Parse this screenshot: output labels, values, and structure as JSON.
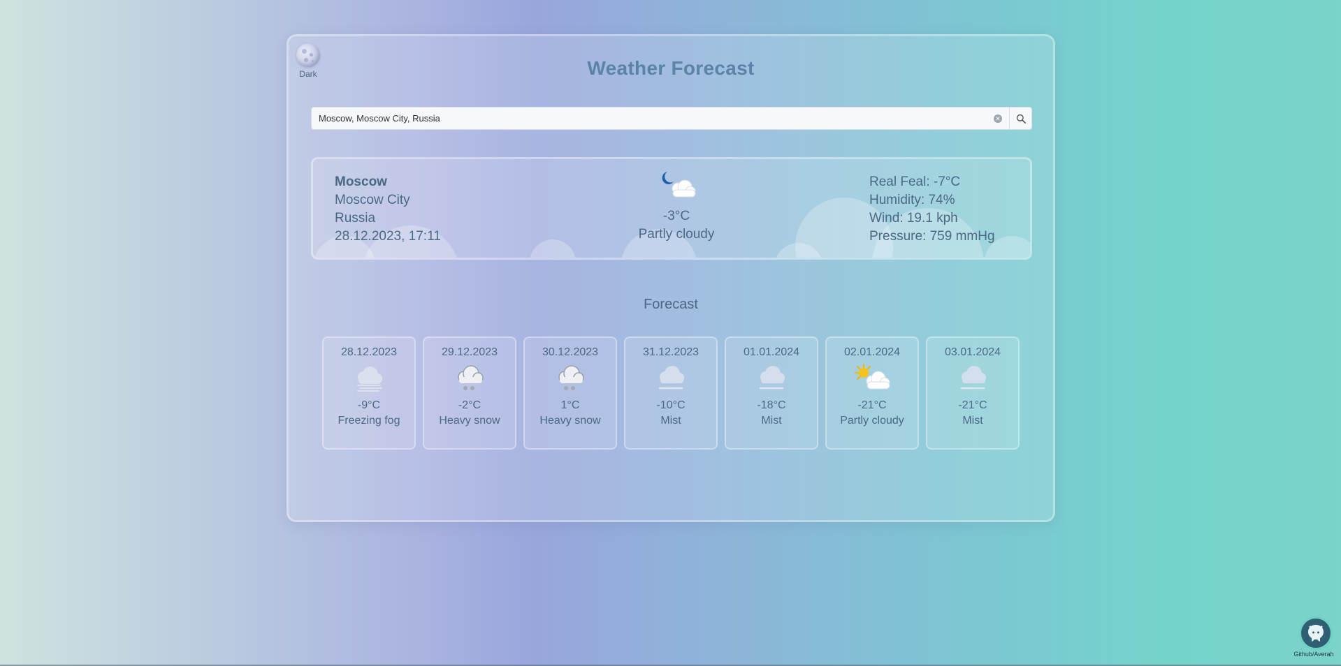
{
  "theme_toggle": {
    "label": "Dark"
  },
  "header": {
    "title": "Weather Forecast"
  },
  "search": {
    "value": "Moscow, Moscow City, Russia",
    "clear_icon": "close-icon",
    "button_icon": "search-icon"
  },
  "current": {
    "city": "Moscow",
    "region": "Moscow City",
    "country": "Russia",
    "datetime": "28.12.2023, 17:11",
    "icon": "moon-cloud-icon",
    "temperature": "-3°C",
    "condition": "Partly cloudy",
    "real_feel": "Real Feal: -7°C",
    "humidity": "Humidity: 74%",
    "wind": "Wind: 19.1 kph",
    "pressure": "Pressure: 759 mmHg"
  },
  "forecast": {
    "title": "Forecast",
    "days": [
      {
        "date": "28.12.2023",
        "icon": "fog-icon",
        "temp": "-9°C",
        "condition": "Freezing fog"
      },
      {
        "date": "29.12.2023",
        "icon": "snow-cloud-icon",
        "temp": "-2°C",
        "condition": "Heavy snow"
      },
      {
        "date": "30.12.2023",
        "icon": "snow-cloud-icon",
        "temp": "1°C",
        "condition": "Heavy snow"
      },
      {
        "date": "31.12.2023",
        "icon": "mist-icon",
        "temp": "-10°C",
        "condition": "Mist"
      },
      {
        "date": "01.01.2024",
        "icon": "mist-icon",
        "temp": "-18°C",
        "condition": "Mist"
      },
      {
        "date": "02.01.2024",
        "icon": "sun-cloud-icon",
        "temp": "-21°C",
        "condition": "Partly cloudy"
      },
      {
        "date": "03.01.2024",
        "icon": "mist-icon",
        "temp": "-21°C",
        "condition": "Mist"
      }
    ]
  },
  "github": {
    "label": "Github/Averah",
    "icon": "github-icon"
  }
}
